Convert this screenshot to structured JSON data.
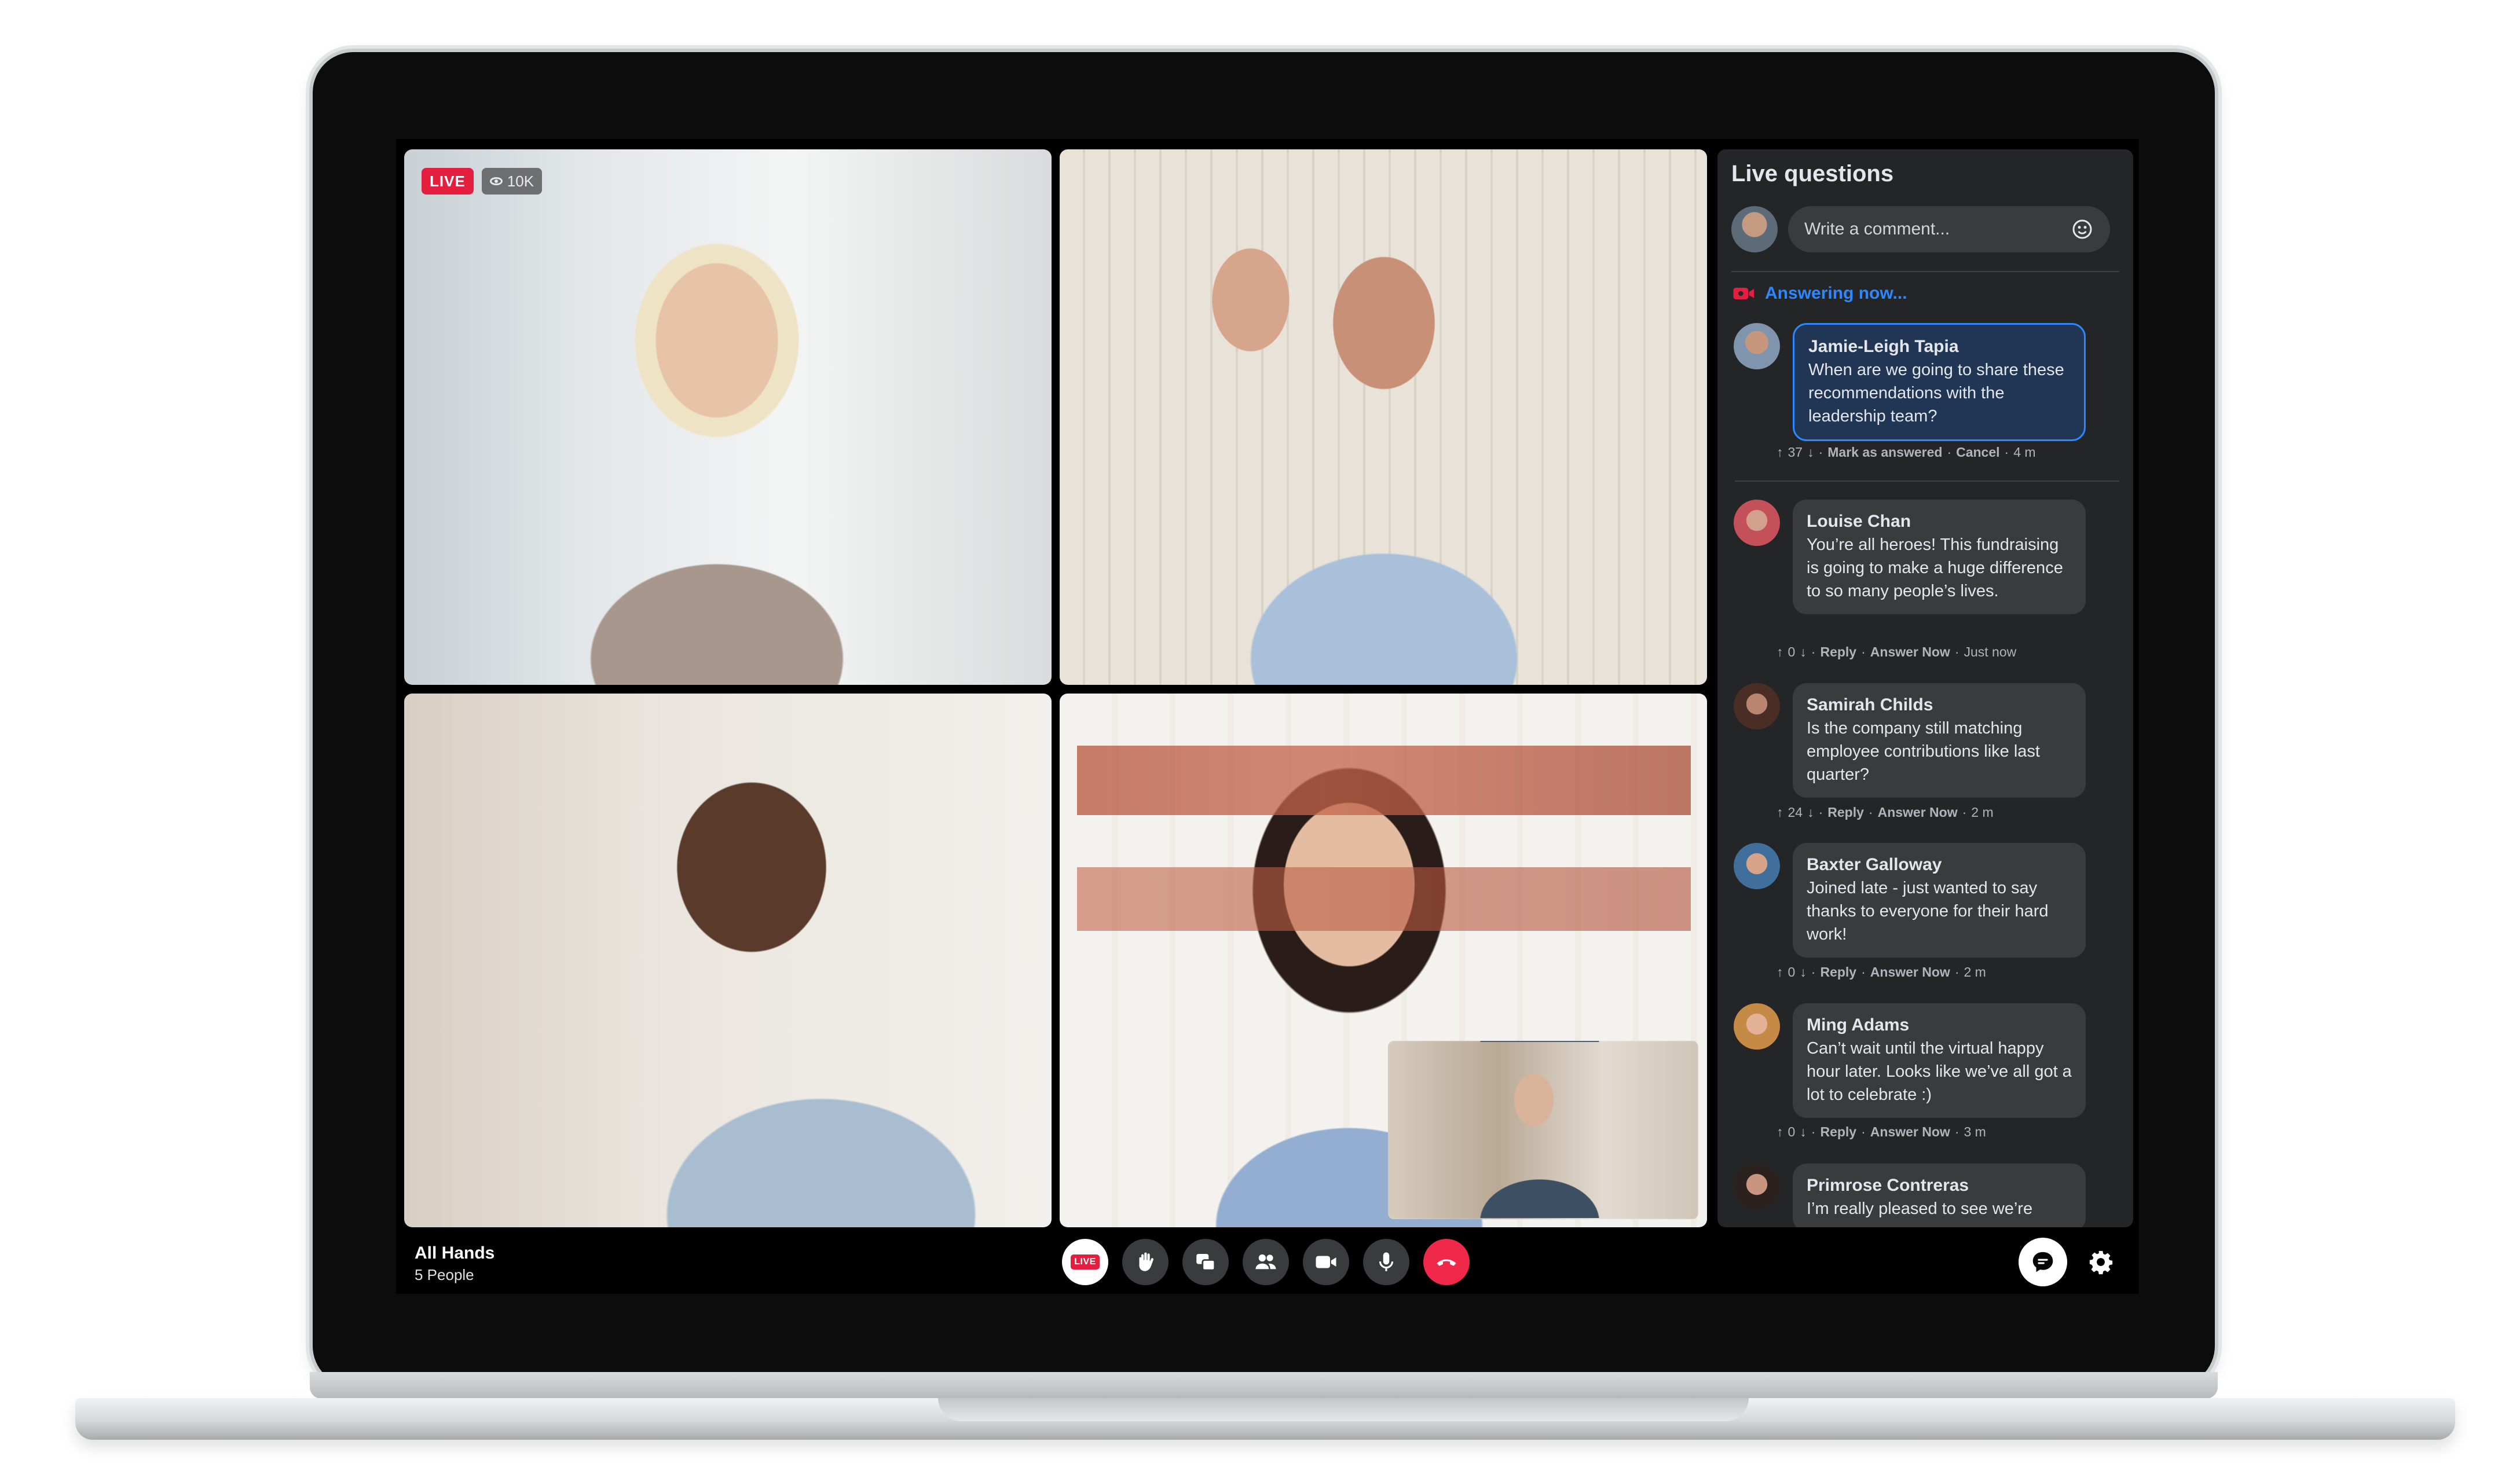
{
  "call": {
    "live_badge": "LIVE",
    "viewers": "10K",
    "meeting_title": "All Hands",
    "meeting_participants": "5 People",
    "control_live_label": "LIVE"
  },
  "panel": {
    "title": "Live questions",
    "comment_placeholder": "Write a comment...",
    "answering_label": "Answering now...",
    "questions": [
      {
        "name": "Jamie-Leigh Tapia",
        "text": "When are we going to share these recommendations with the leadership team?",
        "votes": "37",
        "action_1": "Mark as answered",
        "action_2": "Cancel",
        "time": "4 m"
      },
      {
        "name": "Louise Chan",
        "text": "You’re all heroes! This fundraising is going to make a huge difference to so many people’s lives.",
        "votes": "0",
        "action_1": "Reply",
        "action_2": "Answer Now",
        "time": "Just now"
      },
      {
        "name": "Samirah Childs",
        "text": "Is the company still matching employee contributions like last quarter?",
        "votes": "24",
        "action_1": "Reply",
        "action_2": "Answer Now",
        "time": "2 m"
      },
      {
        "name": "Baxter Galloway",
        "text": "Joined late - just wanted to say thanks to everyone for their hard work!",
        "votes": "0",
        "action_1": "Reply",
        "action_2": "Answer Now",
        "time": "2 m"
      },
      {
        "name": "Ming Adams",
        "text": "Can’t wait until the virtual happy hour later. Looks like we’ve all got a lot to celebrate :)",
        "votes": "0",
        "action_1": "Reply",
        "action_2": "Answer Now",
        "time": "3 m"
      },
      {
        "name": "Primrose Contreras",
        "text": "I’m really pleased to see we’re",
        "votes": "",
        "action_1": "",
        "action_2": "",
        "time": ""
      }
    ]
  },
  "colors": {
    "live_red": "#e41e3f",
    "end_call_red": "#f02849",
    "accent_blue": "#2d88ff",
    "panel_bg": "#242526",
    "bubble_bg": "#3a3b3c"
  },
  "icons": {
    "viewers": "eye-icon",
    "raise_hand": "raise-hand-icon",
    "share_screen": "share-screen-icon",
    "participants": "people-icon",
    "camera": "video-camera-icon",
    "mic": "microphone-icon",
    "end_call": "hang-up-icon",
    "chat": "chat-bubble-icon",
    "settings": "gear-icon",
    "emoji": "smiley-icon",
    "answering": "live-video-icon"
  }
}
